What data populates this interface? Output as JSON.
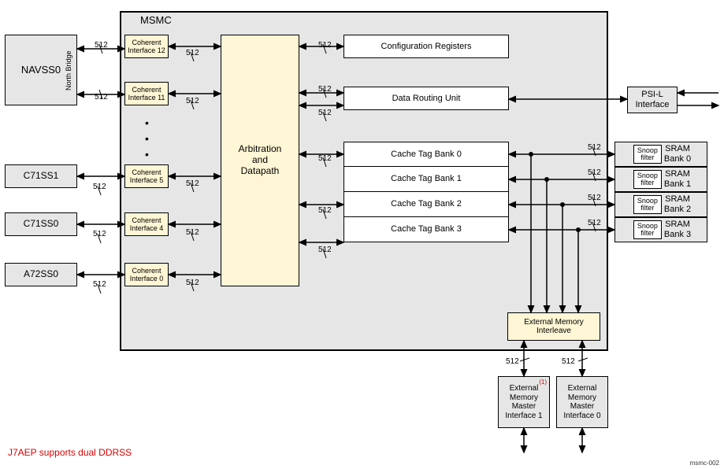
{
  "title": "MSMC",
  "left_blocks": {
    "navss0": "NAVSS0",
    "c71ss1": "C71SS1",
    "c71ss0": "C71SS0",
    "a72ss0": "A72SS0",
    "north_bridge": "North Bridge"
  },
  "coherent_interfaces": {
    "ci12": "Coherent\nInterface 12",
    "ci11": "Coherent\nInterface 11",
    "ci5": "Coherent\nInterface 5",
    "ci4": "Coherent\nInterface 4",
    "ci0": "Coherent\nInterface 0"
  },
  "center": {
    "arbitration": "Arbitration\nand\nDatapath",
    "config_regs": "Configuration Registers",
    "data_routing": "Data Routing Unit",
    "cache_banks": [
      "Cache Tag Bank 0",
      "Cache Tag Bank 1",
      "Cache Tag Bank 2",
      "Cache Tag Bank 3"
    ],
    "ext_interleave": "External Memory\nInterleave"
  },
  "right": {
    "psil": "PSI-L\nInterface",
    "snoop": "Snoop\nfilter",
    "sram_banks": [
      "SRAM\nBank 0",
      "SRAM\nBank 1",
      "SRAM\nBank 2",
      "SRAM\nBank 3"
    ]
  },
  "ext_masters": {
    "m1": "External\nMemory\nMaster\nInterface 1",
    "m0": "External\nMemory\nMaster\nInterface 0",
    "m1_sup": "(1)"
  },
  "bus_width": "512",
  "footer": "J7AEP supports dual DDRSS",
  "corner_id": "msmc-002"
}
